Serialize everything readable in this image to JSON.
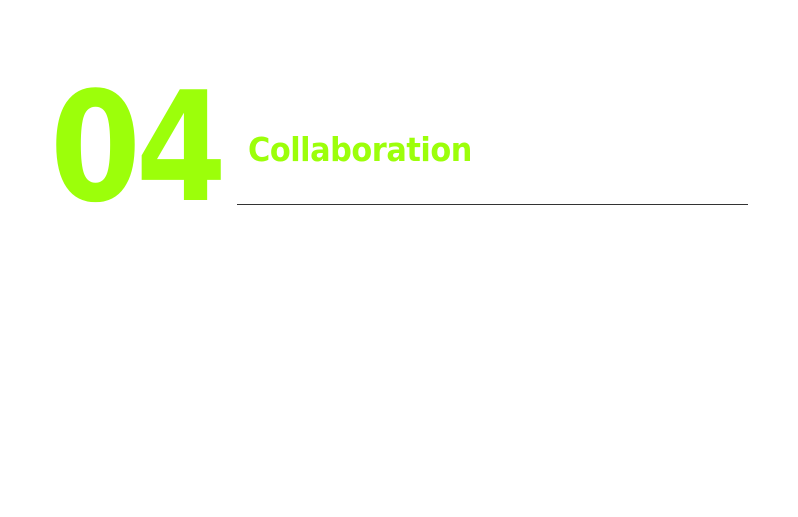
{
  "section": {
    "number": "04",
    "title": "Collaboration"
  },
  "colors": {
    "accent": "#9cff0a",
    "divider": "#333333",
    "background": "#ffffff"
  }
}
